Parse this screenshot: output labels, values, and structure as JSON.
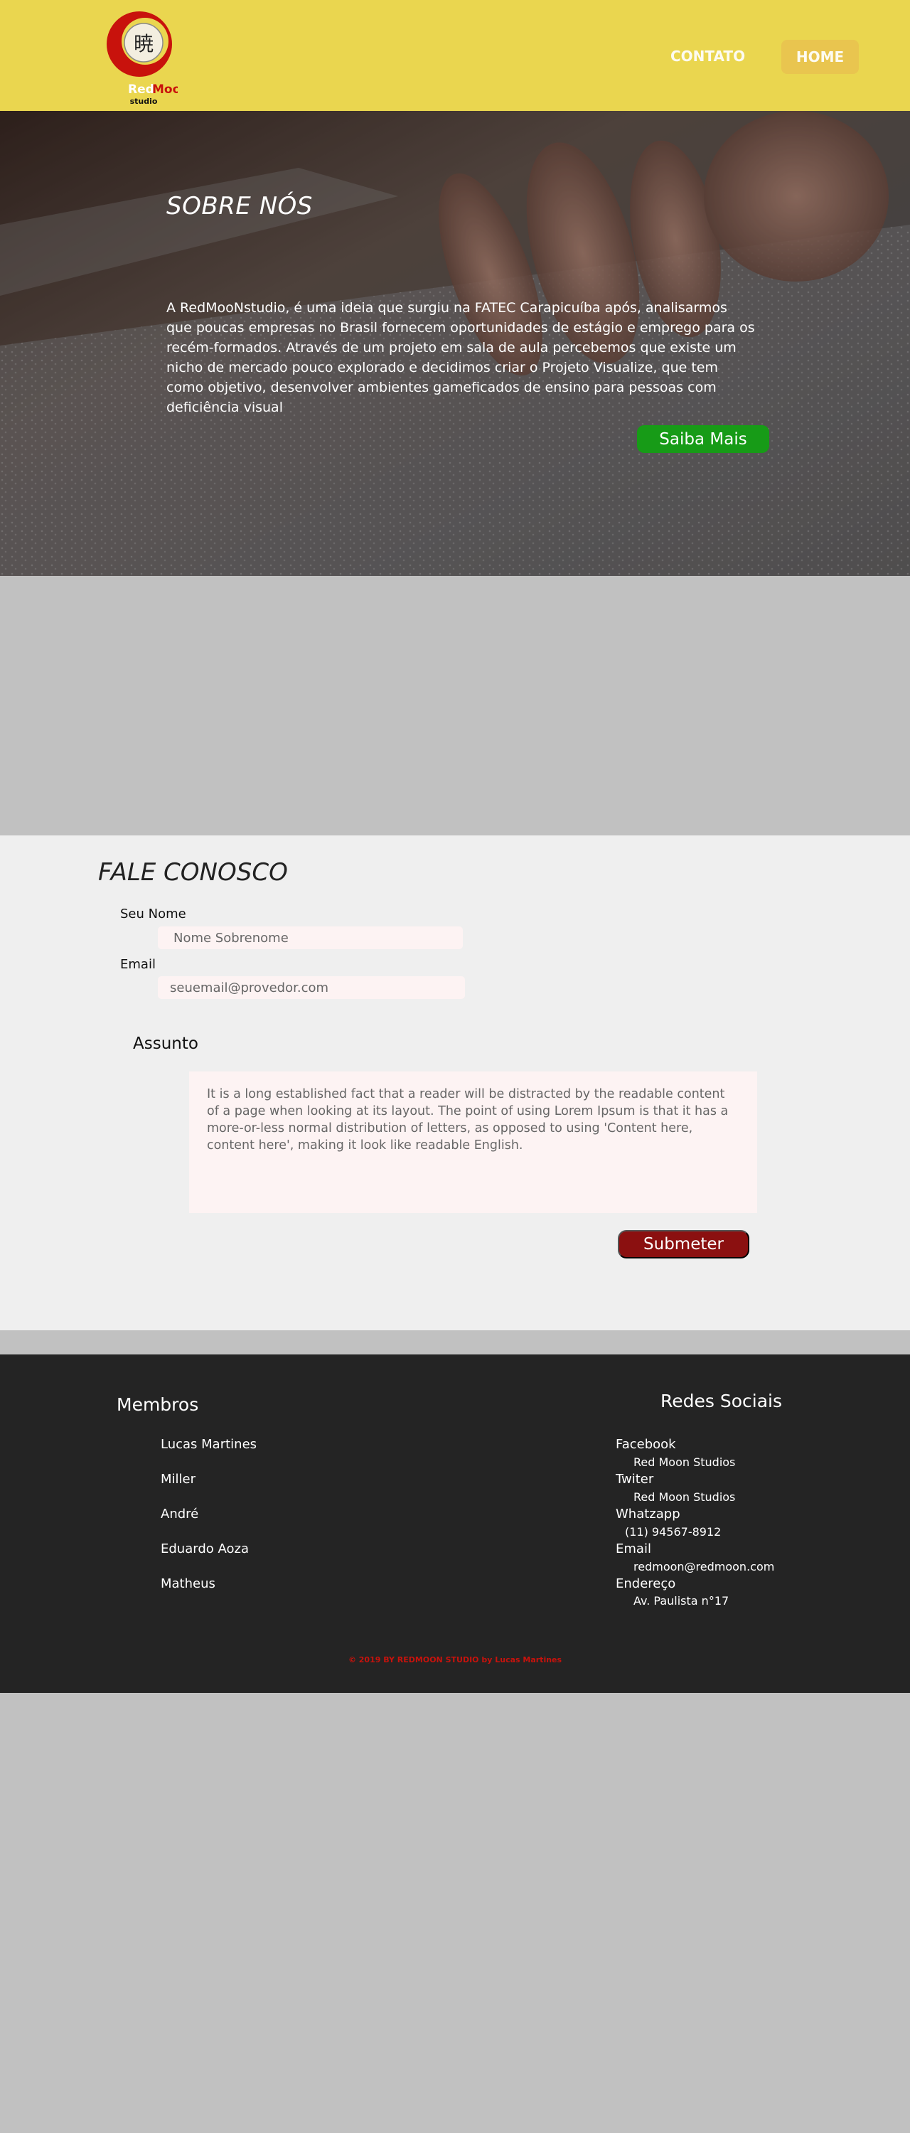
{
  "header": {
    "logo": {
      "glyph": "暁",
      "brand_red": "Red",
      "brand_moon": "MooN",
      "sub": "studio"
    },
    "nav": {
      "contato": "CONTATO",
      "home": "HOME"
    }
  },
  "hero": {
    "title": "SOBRE NÓS",
    "text": "A RedMooNstudio, é uma  ideia que surgiu na FATEC Carapicuíba após, analisarmos que poucas empresas no Brasil fornecem oportunidades de estágio e emprego para os recém-formados. Através de um projeto em sala de aula percebemos que existe um nicho de mercado pouco explorado e decidimos criar o Projeto Visualize, que tem como objetivo, desenvolver ambientes gameficados de ensino para pessoas com deficiência visual",
    "button": "Saiba Mais"
  },
  "contact": {
    "title": "FALE CONOSCO",
    "name_label": "Seu Nome",
    "name_placeholder": "Nome Sobrenome",
    "email_label": "Email",
    "email_placeholder": "seuemail@provedor.com",
    "subject_label": "Assunto",
    "subject_text": "It is a long established fact that a reader will be distracted by the readable content of a page when looking at its layout. The point of using Lorem Ipsum is that it has a more-or-less normal distribution of letters, as opposed to using 'Content here, content here', making it look like readable English.",
    "submit": "Submeter"
  },
  "footer": {
    "members_title": "Membros",
    "members": [
      "Lucas Martines",
      "Miller",
      "André",
      "Eduardo Aoza",
      "Matheus"
    ],
    "social_title": "Redes Sociais",
    "social": [
      {
        "name": "Facebook",
        "value": "Red Moon Studios"
      },
      {
        "name": "Twiter",
        "value": "Red Moon Studios"
      },
      {
        "name": "Whatzapp",
        "value": "(11) 94567-8912"
      },
      {
        "name": "Email",
        "value": "redmoon@redmoon.com"
      },
      {
        "name": "Endereço",
        "value": "Av. Paulista n°17"
      }
    ],
    "copyright": "© 2019 BY REDMOON STUDIO by Lucas Martines"
  },
  "colors": {
    "header_bg": "#ead64f",
    "home_button": "#e9c44f",
    "saiba_button": "#179b17",
    "submit_button": "#8b1010",
    "footer_bg": "#242424",
    "copyright": "#c8120c"
  }
}
